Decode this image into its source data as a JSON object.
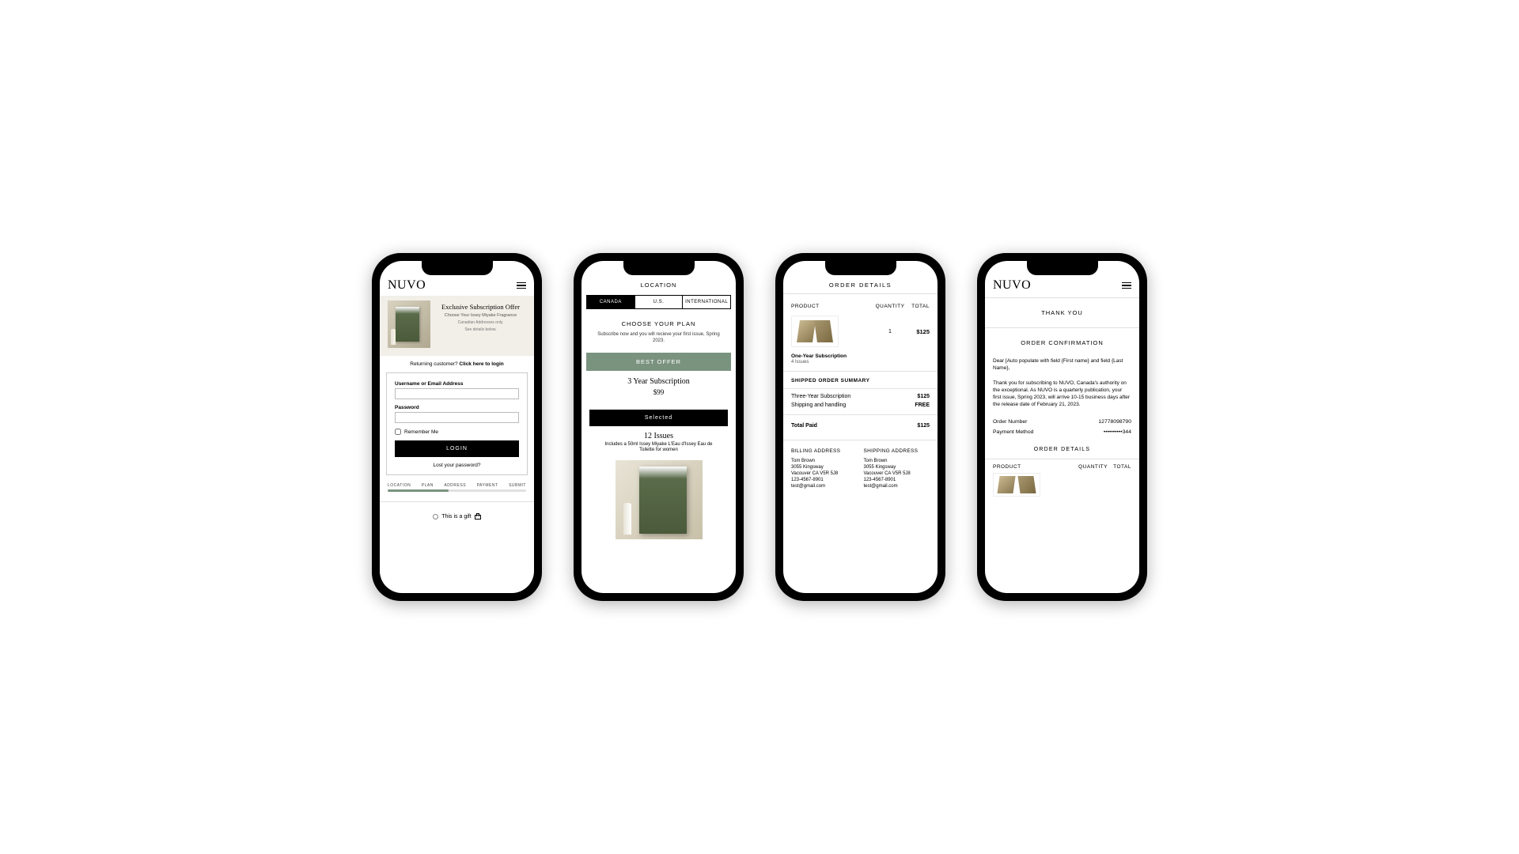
{
  "brand": "NUVO",
  "phone1": {
    "hero": {
      "title": "Exclusive Subscription Offer",
      "subtitle": "Choose Your Issey Miyake Fragrance",
      "note1": "Canadian Addresses only.",
      "note2": "See details below."
    },
    "returning_prefix": "Returning customer? ",
    "returning_link": "Click here to login",
    "username_label": "Username or Email Address",
    "password_label": "Password",
    "remember_label": "Remember Me",
    "login_btn": "LOGIN",
    "lost_pw": "Lost your password?",
    "steps": [
      "LOCATION",
      "PLAN",
      "ADDRESS",
      "PAYMENT",
      "SUBMIT"
    ],
    "gift_label": "This is a gift"
  },
  "phone2": {
    "location_title": "LOCATION",
    "tabs": [
      "CANADA",
      "U.S.",
      "INTERNATIONAL"
    ],
    "choose_title": "CHOOSE YOUR PLAN",
    "choose_sub": "Subscribe now and you will recieve your first issue, Spring 2023.",
    "best_offer": "BEST OFFER",
    "plan_name": "3 Year Subscription",
    "plan_price": "$99",
    "selected_btn": "Selected",
    "issues": "12 Issues",
    "includes": "Includes a 50ml Issey Miyake L'Eau d'Issey Eau de Toilette for women"
  },
  "phone3": {
    "title": "ORDER DETAILS",
    "cols": {
      "product": "PRODUCT",
      "qty": "QUANTITY",
      "total": "TOTAL"
    },
    "line_qty": "1",
    "line_total": "$125",
    "sub_name": "One-Year Subscription",
    "sub_issues": "4 Issues",
    "summary_title": "SHIPPED ORDER SUMMARY",
    "rows": [
      {
        "label": "Three-Year Subscription",
        "value": "$125"
      },
      {
        "label": "Shipping and handling",
        "value": "FREE"
      }
    ],
    "total_label": "Total Paid",
    "total_value": "$125",
    "billing_title": "BILLING ADDRESS",
    "shipping_title": "SHIPPING ADDRESS",
    "addr": {
      "name": "Tom Brown",
      "street": "3055 Kingsway",
      "city": "Vacouver CA V5R 5J8",
      "phone": "123-4567-8901",
      "email": "test@gmail.com"
    }
  },
  "phone4": {
    "thank_you": "THANK YOU",
    "conf_title": "ORDER CONFIRMATION",
    "greeting": "Dear [Auto populate with field {First name} and field {Last Name},",
    "message": "Thank you for subscribing to NUVO, Canada's authority on the exceptional. As NUVO is a quarterly publication, your first issue, Spring 2023, will arrive 10-15 business days after the release date of February 21, 2023.",
    "order_num_label": "Order Number",
    "order_num": "12778098790",
    "payment_label": "Payment Method",
    "payment_value": "••••••••••344",
    "details_title": "ORDER DETAILS",
    "cols": {
      "product": "PRODUCT",
      "qty": "QUANTITY",
      "total": "TOTAL"
    }
  }
}
